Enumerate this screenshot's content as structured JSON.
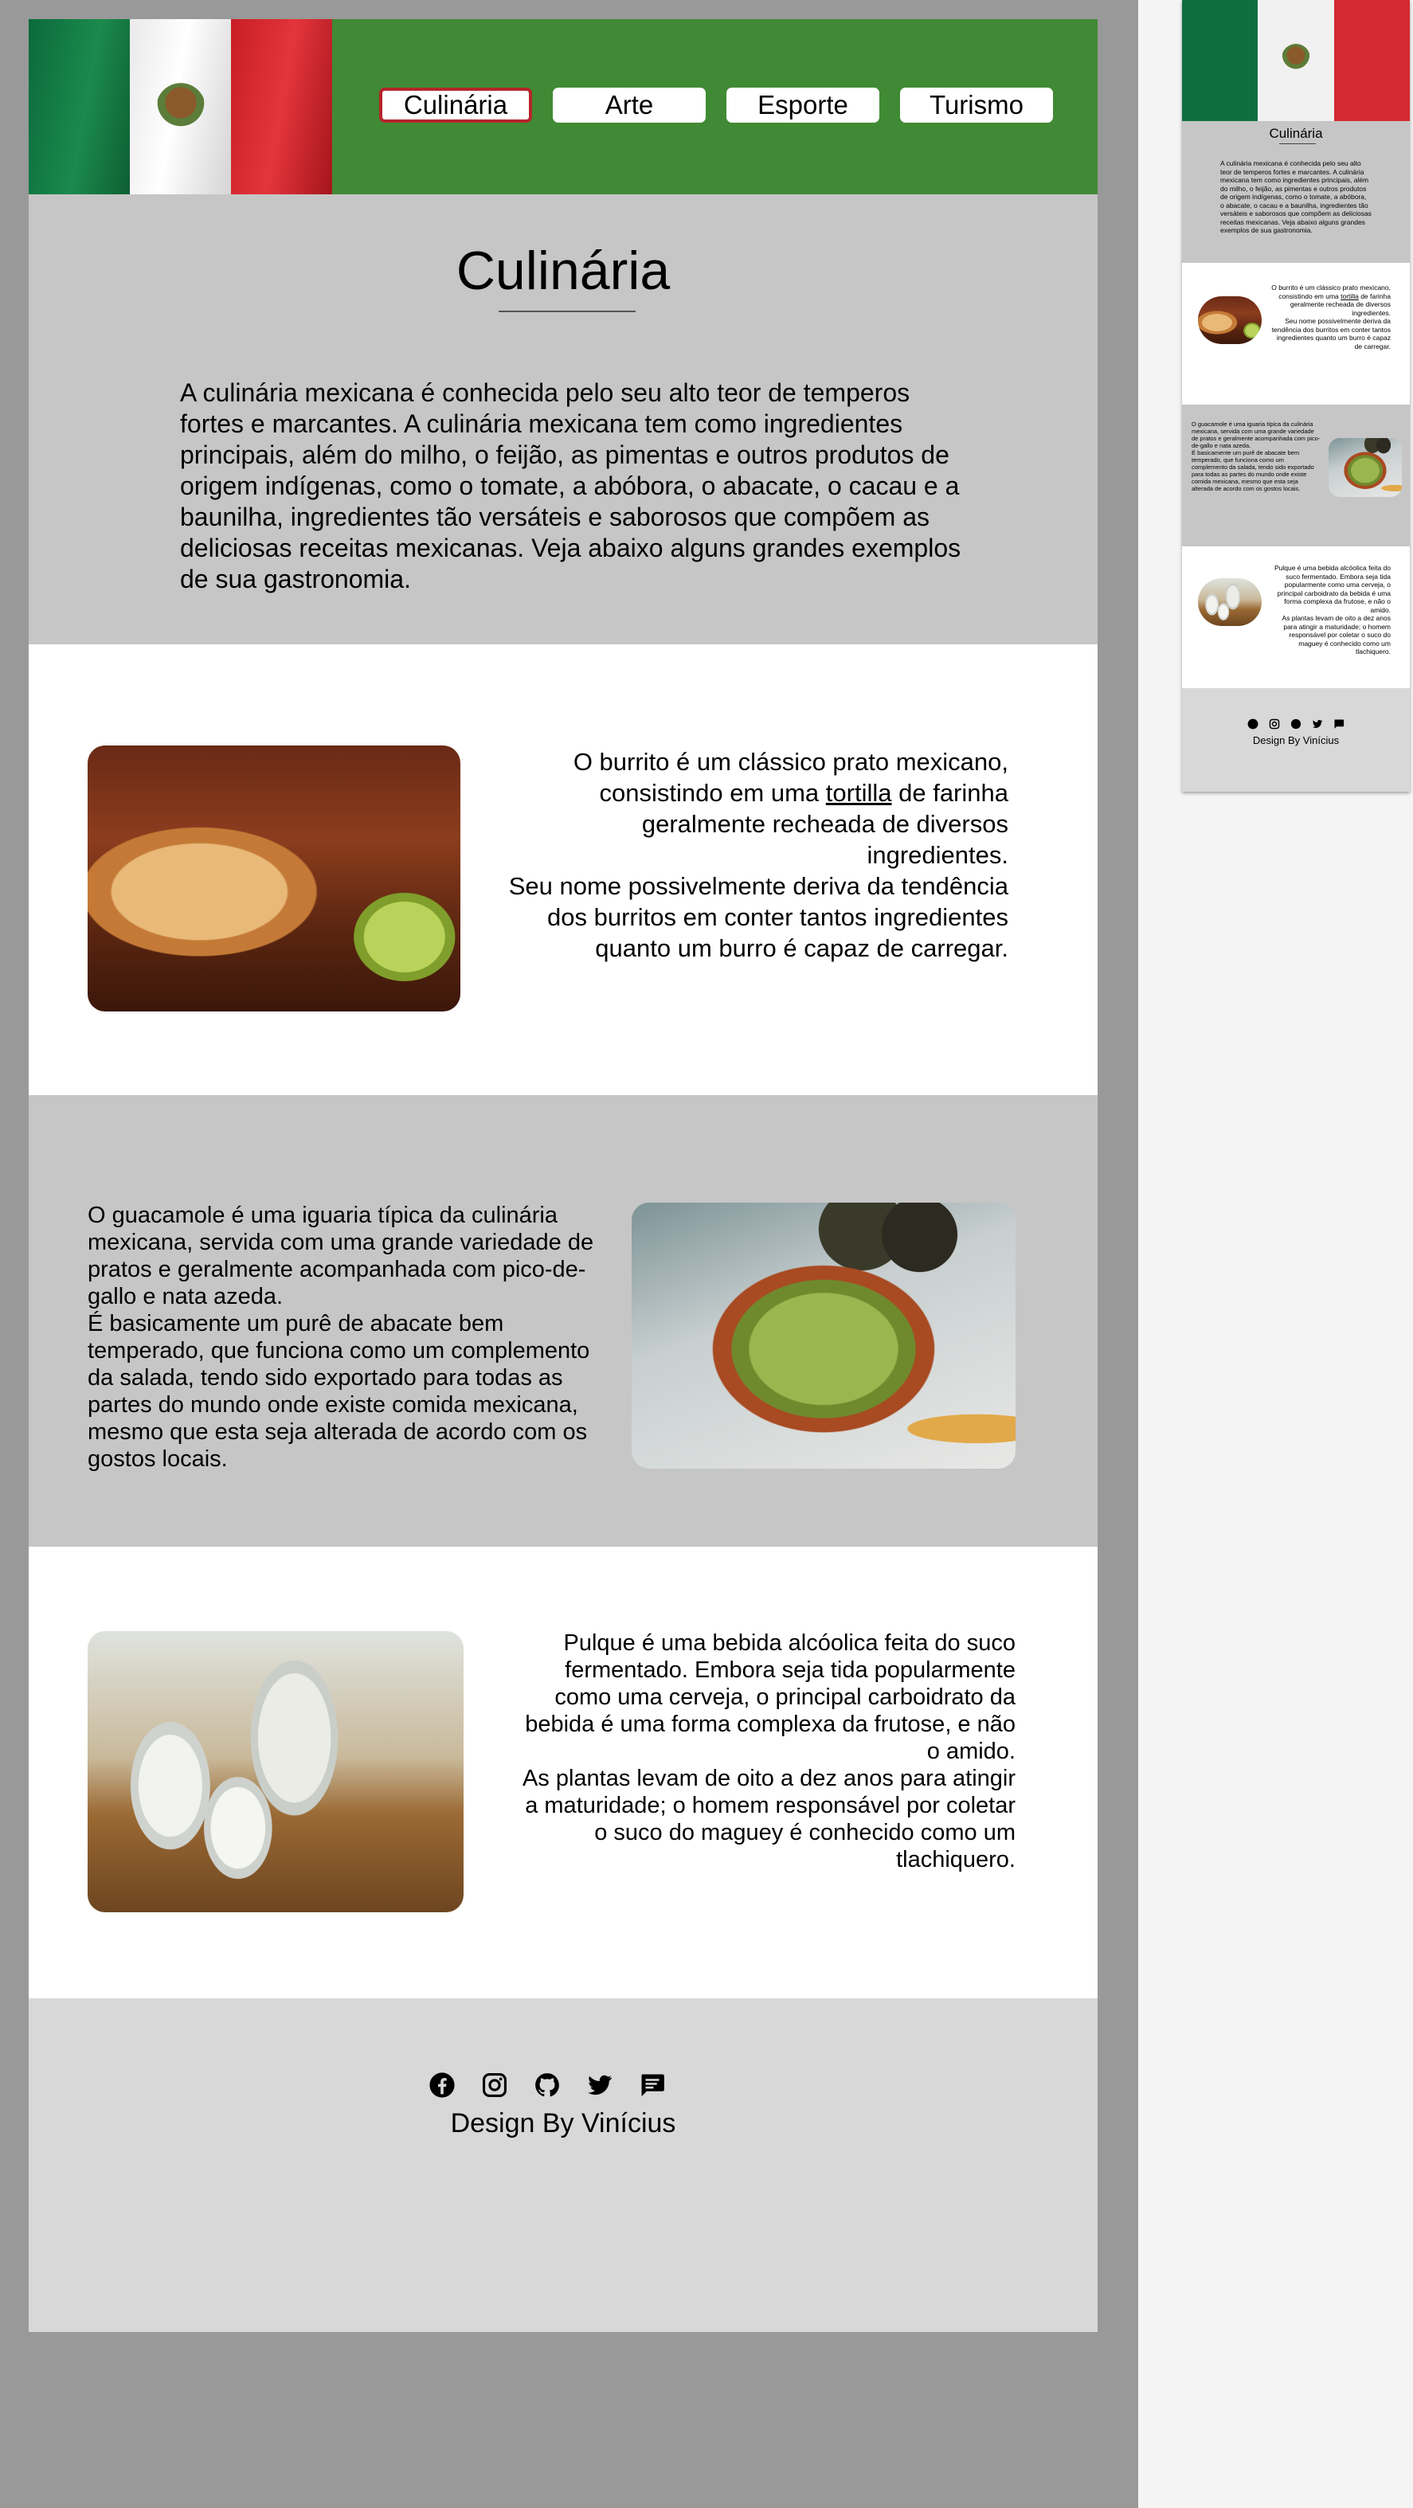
{
  "nav": {
    "items": [
      "Culinária",
      "Arte",
      "Esporte",
      "Turismo"
    ],
    "active": "Culinária"
  },
  "intro": {
    "title": "Culinária",
    "text": "A culinária mexicana é conhecida pelo seu alto teor de temperos fortes e marcantes. A culinária mexicana tem como ingredientes principais, além do milho, o feijão, as pimentas e outros produtos de origem indígenas, como o tomate, a abóbora, o abacate, o cacau e a baunilha, ingredientes tão versáteis e saborosos que compõem as deliciosas receitas mexicanas. Veja abaixo alguns grandes exemplos de sua gastronomia."
  },
  "burrito": {
    "text_before": "O burrito é um clássico prato mexicano, consistindo em uma ",
    "link": "tortilla",
    "text_after": " de farinha geralmente recheada de diversos ingredientes.",
    "text2": "Seu nome possivelmente deriva da tendência dos burritos em conter tantos ingredientes quanto um burro é capaz de carregar."
  },
  "guacamole": {
    "text1": "O guacamole é uma iguaria típica da culinária mexicana, servida com uma grande variedade de pratos e geralmente acompanhada com pico-de-gallo e nata azeda.",
    "text2": "É basicamente um purê de abacate bem temperado, que funciona como um complemento da salada, tendo sido exportado para todas as partes do mundo onde existe comida mexicana, mesmo que esta seja alterada de acordo com os gostos locais."
  },
  "pulque": {
    "text1": "Pulque é uma bebida alcóolica feita do suco fermentado. Embora seja tida popularmente como uma cerveja, o principal carboidrato da bebida é uma forma complexa da frutose, e não o amido.",
    "text2": "As plantas levam de oito a dez anos para atingir a maturidade; o homem responsável por coletar o suco do maguey é conhecido como um tlachiquero."
  },
  "footer": {
    "icons": [
      "facebook-icon",
      "instagram-icon",
      "github-icon",
      "twitter-icon",
      "chat-icon"
    ],
    "credit": "Design By Vinícius"
  },
  "colors": {
    "header_green": "#418a35",
    "section_gray": "#c6c6c6",
    "footer_gray": "#d8d8d8",
    "active_border": "#b5252a",
    "backdrop": "#999999"
  }
}
